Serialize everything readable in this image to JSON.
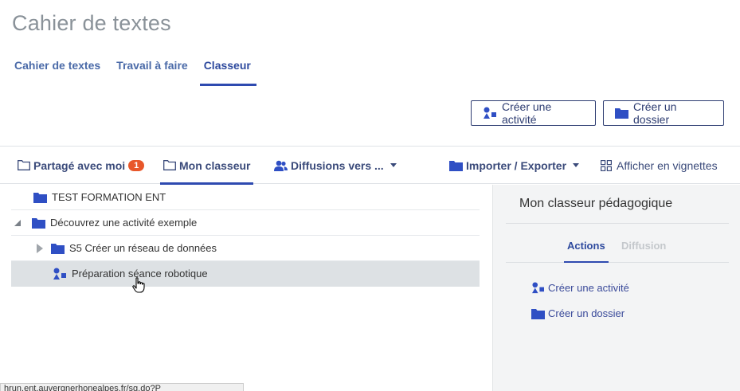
{
  "page": {
    "title": "Cahier de textes"
  },
  "top_tabs": [
    {
      "label": "Cahier de textes",
      "active": false
    },
    {
      "label": "Travail à faire",
      "active": false
    },
    {
      "label": "Classeur",
      "active": true
    }
  ],
  "toolbar": {
    "create_activity_label": "Créer une activité",
    "create_folder_label": "Créer un dossier"
  },
  "sub_tabs": {
    "shared": {
      "label": "Partagé avec moi",
      "badge": "1"
    },
    "mine": {
      "label": "Mon classeur"
    },
    "diffusions": {
      "label": "Diffusions vers ..."
    },
    "import_export": {
      "label": "Importer / Exporter"
    },
    "thumbnails": {
      "label": "Afficher en vignettes"
    }
  },
  "tree": [
    {
      "label": "TEST FORMATION ENT",
      "type": "folder",
      "level": 0
    },
    {
      "label": "Découvrez une activité exemple",
      "type": "folder",
      "level": 0,
      "expanded": true
    },
    {
      "label": "S5 Créer un réseau de données",
      "type": "folder",
      "level": 1,
      "expanded": false
    },
    {
      "label": "Préparation séance robotique",
      "type": "activity",
      "level": 1,
      "selected": true
    }
  ],
  "side_panel": {
    "title": "Mon classeur pédagogique",
    "tabs": [
      {
        "label": "Actions",
        "active": true
      },
      {
        "label": "Diffusion",
        "active": false
      }
    ],
    "actions": [
      {
        "label": "Créer une activité",
        "icon": "activity-icon"
      },
      {
        "label": "Créer un dossier",
        "icon": "folder-icon"
      }
    ]
  },
  "status_bar": {
    "url": "hrun.ent.auvergnerhonealpes.fr/sg.do?P"
  },
  "colors": {
    "accent": "#2e4ab0",
    "folder": "#2f4fc4",
    "badge": "#e8572a",
    "selected_row": "#dde1e4",
    "side_bg": "#f3f4f5"
  }
}
